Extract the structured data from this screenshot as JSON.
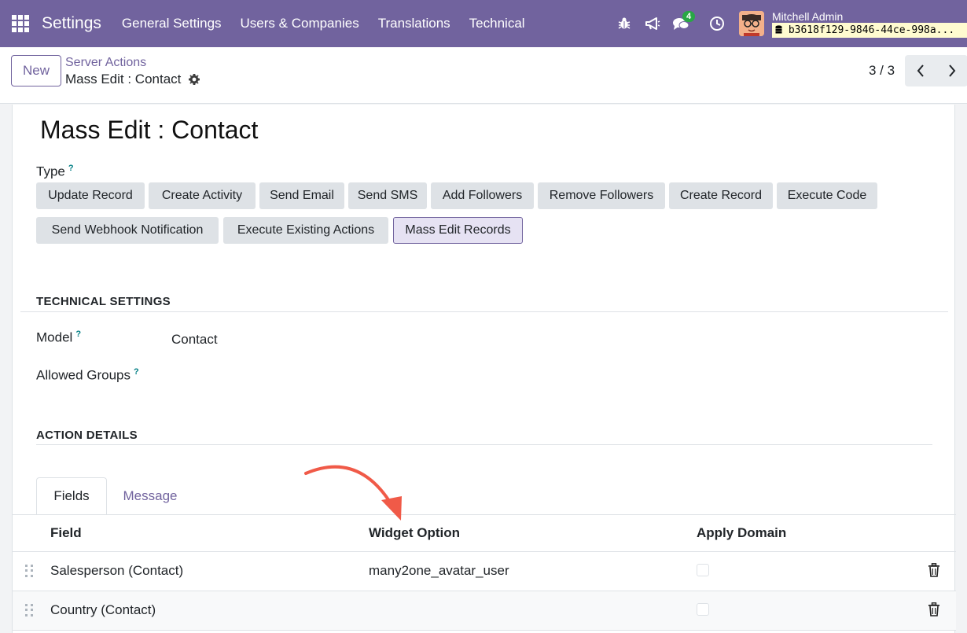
{
  "navbar": {
    "brand": "Settings",
    "menu": [
      "General Settings",
      "Users & Companies",
      "Translations",
      "Technical"
    ],
    "chat_badge": "4",
    "user_name": "Mitchell Admin",
    "db_name": "b3618f129-9846-44ce-998a..."
  },
  "control": {
    "new_label": "New",
    "breadcrumb_parent": "Server Actions",
    "breadcrumb_current": "Mass Edit : Contact",
    "pager": "3 / 3"
  },
  "form": {
    "title": "Mass Edit : Contact",
    "type_label": "Type",
    "types": [
      "Update Record",
      "Create Activity",
      "Send Email",
      "Send SMS",
      "Add Followers",
      "Remove Followers",
      "Create Record",
      "Execute Code",
      "Send Webhook Notification",
      "Execute Existing Actions",
      "Mass Edit Records"
    ],
    "active_type": "Mass Edit Records",
    "technical_title": "TECHNICAL SETTINGS",
    "model_label": "Model",
    "model_value": "Contact",
    "groups_label": "Allowed Groups",
    "action_title": "ACTION DETAILS",
    "help": "?"
  },
  "tabs": [
    "Fields",
    "Message"
  ],
  "table": {
    "columns": [
      "Field",
      "Widget Option",
      "Apply Domain"
    ],
    "rows": [
      {
        "field": "Salesperson (Contact)",
        "widget": "many2one_avatar_user"
      },
      {
        "field": "Country (Contact)",
        "widget": ""
      }
    ]
  },
  "colors": {
    "brand": "#71639e",
    "annotation_arrow": "#f05a48"
  }
}
